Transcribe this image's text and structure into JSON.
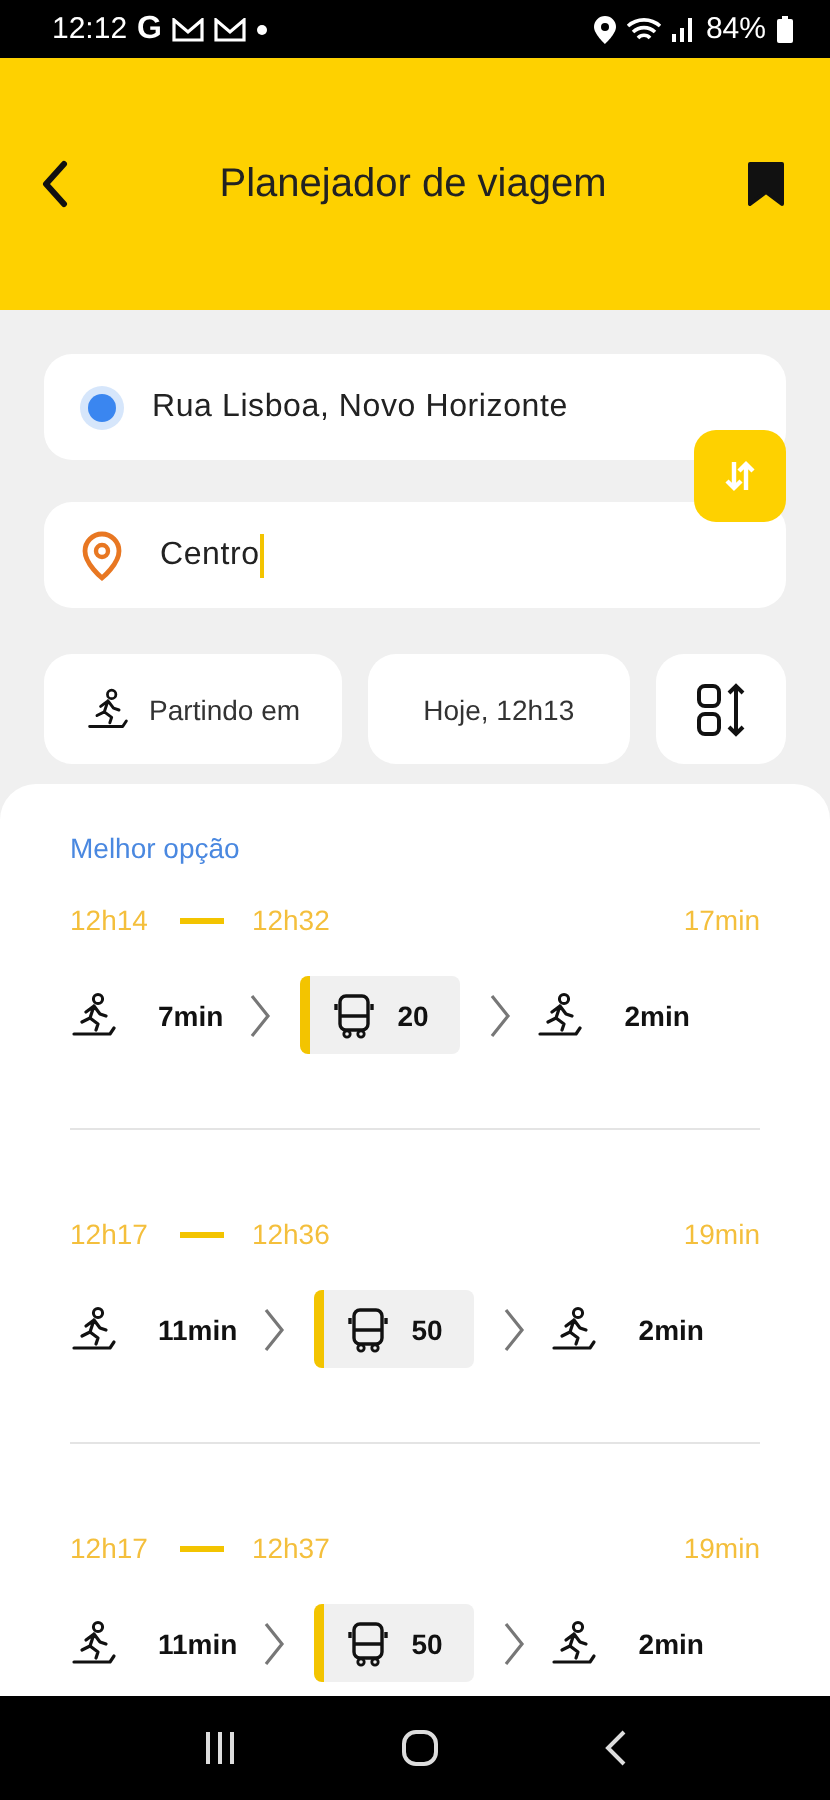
{
  "status_bar": {
    "time": "12:12",
    "carrier": "G",
    "battery": "84%"
  },
  "header": {
    "title": "Planejador de viagem"
  },
  "origin": {
    "value": "Rua Lisboa, Novo Horizonte",
    "focused": false
  },
  "destination": {
    "value": "Centro",
    "focused": true
  },
  "departure": {
    "mode": "Partindo em",
    "time": "Hoje, 12h13"
  },
  "trips": [
    {
      "label": "Melhor opção",
      "depart": "12h14",
      "arrive": "12h32",
      "duration": "17min",
      "legs": [
        {
          "kind": "walk",
          "text": "7min"
        },
        {
          "kind": "bus",
          "text": "20"
        },
        {
          "kind": "walk",
          "text": "2min"
        }
      ]
    },
    {
      "depart": "12h17",
      "arrive": "12h36",
      "duration": "19min",
      "legs": [
        {
          "kind": "walk",
          "text": "11min"
        },
        {
          "kind": "bus",
          "text": "50"
        },
        {
          "kind": "walk",
          "text": "2min"
        }
      ]
    },
    {
      "depart": "12h17",
      "arrive": "12h37",
      "duration": "19min",
      "legs": [
        {
          "kind": "walk",
          "text": "11min"
        },
        {
          "kind": "bus",
          "text": "50"
        },
        {
          "kind": "walk",
          "text": "2min"
        }
      ]
    }
  ]
}
